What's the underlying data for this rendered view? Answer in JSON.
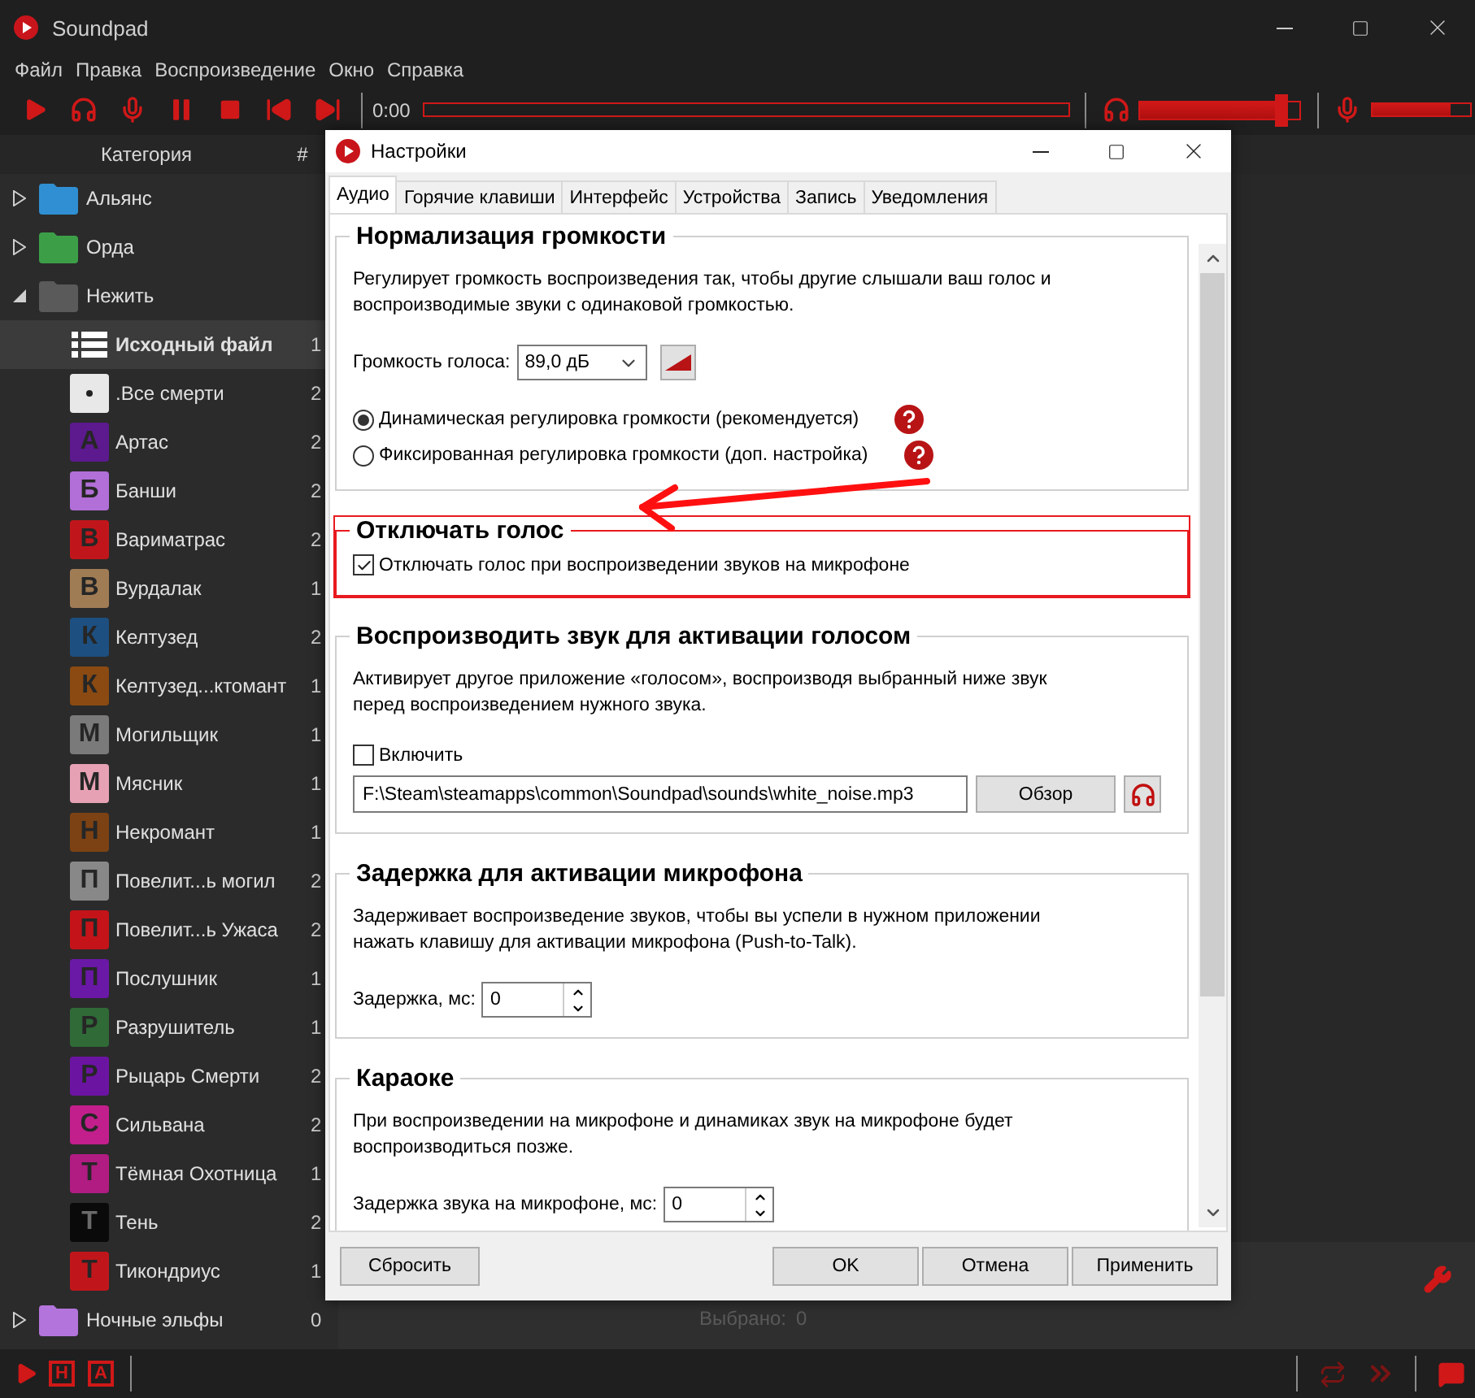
{
  "window": {
    "title": "Soundpad"
  },
  "menu": [
    "Файл",
    "Правка",
    "Воспроизведение",
    "Окно",
    "Справка"
  ],
  "player": {
    "time": "0:00",
    "progress": {
      "level": 0
    },
    "volume": {
      "level": 0.93
    },
    "mic": {
      "level": 0.8
    }
  },
  "sidebar": {
    "header": "Категория",
    "count_header": "#",
    "items": [
      {
        "label": "Альянс",
        "kind": "folder",
        "color": "#2f8fd2",
        "expanded": false,
        "selected": false
      },
      {
        "label": "Орда",
        "kind": "folder",
        "color": "#3c9f48",
        "expanded": false,
        "selected": false
      },
      {
        "label": "Нежить",
        "kind": "folder",
        "color": "#5a5a5a",
        "expanded": true,
        "selected": false,
        "children": [
          {
            "label": "Исходный файл",
            "count": "1",
            "kind": "list",
            "selected": true
          },
          {
            "label": ".Все смерти",
            "count": "2",
            "kind": "dot",
            "color": "#e8e8e8",
            "selected": false
          },
          {
            "label": "Артас",
            "count": "2",
            "kind": "letter",
            "badge": "А",
            "color": "#5c1a8e",
            "selected": false
          },
          {
            "label": "Банши",
            "count": "2",
            "kind": "letter",
            "badge": "Б",
            "color": "#b26fd8",
            "selected": false
          },
          {
            "label": "Вариматрас",
            "count": "2",
            "kind": "letter",
            "badge": "В",
            "color": "#c0161b",
            "selected": false
          },
          {
            "label": "Вурдалак",
            "count": "1",
            "kind": "letter",
            "badge": "В",
            "color": "#a07c55",
            "selected": false
          },
          {
            "label": "Келтузед",
            "count": "2",
            "kind": "letter",
            "badge": "К",
            "color": "#1d4f80",
            "selected": false
          },
          {
            "label": "Келтузед...ктомант",
            "count": "1",
            "kind": "letter",
            "badge": "К",
            "color": "#8a4a12",
            "selected": false
          },
          {
            "label": "Могильщик",
            "count": "1",
            "kind": "letter",
            "badge": "М",
            "color": "#7a7a7a",
            "selected": false
          },
          {
            "label": "Мясник",
            "count": "1",
            "kind": "letter",
            "badge": "М",
            "color": "#e6a1b4",
            "selected": false
          },
          {
            "label": "Некромант",
            "count": "1",
            "kind": "letter",
            "badge": "Н",
            "color": "#7c4214",
            "selected": false
          },
          {
            "label": "Повелит...ь могил",
            "count": "2",
            "kind": "letter",
            "badge": "П",
            "color": "#888888",
            "selected": false
          },
          {
            "label": "Повелит...ь Ужаса",
            "count": "2",
            "kind": "letter",
            "badge": "П",
            "color": "#c41419",
            "selected": false
          },
          {
            "label": "Послушник",
            "count": "1",
            "kind": "letter",
            "badge": "П",
            "color": "#6a18a6",
            "selected": false
          },
          {
            "label": "Разрушитель",
            "count": "1",
            "kind": "letter",
            "badge": "Р",
            "color": "#2f6a37",
            "selected": false
          },
          {
            "label": "Рыцарь Смерти",
            "count": "2",
            "kind": "letter",
            "badge": "Р",
            "color": "#6c14a2",
            "selected": false
          },
          {
            "label": "Сильвана",
            "count": "2",
            "kind": "letter",
            "badge": "С",
            "color": "#c21f8c",
            "selected": false
          },
          {
            "label": "Тёмная Охотница",
            "count": "1",
            "kind": "letter",
            "badge": "Т",
            "color": "#b01c82",
            "selected": false
          },
          {
            "label": "Тень",
            "count": "2",
            "kind": "letter",
            "badge": "Т",
            "color": "#0a0a0a",
            "selected": false
          },
          {
            "label": "Тикондриус",
            "count": "1",
            "kind": "letter",
            "badge": "Т",
            "color": "#c0161b",
            "selected": false
          }
        ]
      },
      {
        "label": "Ночные эльфы",
        "count": "0",
        "kind": "folder",
        "color": "#b374dc",
        "expanded": false,
        "selected": false
      }
    ]
  },
  "status": {
    "label": "Выбрано:",
    "value": "0"
  },
  "bottom_toolbar": [
    {
      "kind": "play"
    },
    {
      "kind": "letter",
      "label": "Н"
    },
    {
      "kind": "letter",
      "label": "А"
    }
  ],
  "dialog": {
    "title": "Настройки",
    "tabs": [
      {
        "label": "Аудио",
        "selected": true
      },
      {
        "label": "Горячие клавиши",
        "selected": false
      },
      {
        "label": "Интерфейс",
        "selected": false
      },
      {
        "label": "Устройства",
        "selected": false
      },
      {
        "label": "Запись",
        "selected": false
      },
      {
        "label": "Уведомления",
        "selected": false
      }
    ],
    "groups": [
      {
        "kind": "normalization",
        "title": "Нормализация громкости",
        "highlighted": false,
        "description": "Регулирует громкость воспроизведения так, чтобы другие слышали ваш голос и воспроизводимые звуки с одинаковой громкостью.",
        "volume_label": "Громкость голоса:",
        "volume_value": "89,0 дБ",
        "options": [
          {
            "label": "Динамическая регулировка громкости (рекомендуется)",
            "selected": true
          },
          {
            "label": "Фиксированная регулировка громкости (доп. настройка)",
            "selected": false
          }
        ]
      },
      {
        "kind": "mute",
        "title": "Отключать голос",
        "highlighted": true,
        "checkbox": {
          "label": "Отключать голос при воспроизведении звуков на микрофоне",
          "checked": true
        }
      },
      {
        "kind": "activation",
        "title": "Воспроизводить звук для активации голосом",
        "highlighted": false,
        "description": "Активирует другое приложение «голосом», воспроизводя выбранный ниже звук перед воспроизведением нужного звука.",
        "checkbox": {
          "label": "Включить",
          "checked": false
        },
        "path": "F:\\Steam\\steamapps\\common\\Soundpad\\sounds\\white_noise.mp3",
        "browse": "Обзор"
      },
      {
        "kind": "delay",
        "title": "Задержка для активации микрофона",
        "highlighted": false,
        "description": "Задерживает воспроизведение звуков, чтобы вы успели в нужном приложении нажать клавишу для активации микрофона (Push-to-Talk).",
        "field_label": "Задержка, мс:",
        "field_value": "0"
      },
      {
        "kind": "delay",
        "title": "Караоке",
        "highlighted": false,
        "description": "При воспроизведении на микрофоне и динамиках звук на микрофоне будет воспроизводиться позже.",
        "field_label": "Задержка звука на микрофоне, мс:",
        "field_value": "0"
      }
    ],
    "buttons": [
      {
        "kind": "reset",
        "label": "Сбросить"
      },
      {
        "kind": "ok",
        "label": "OK"
      },
      {
        "kind": "cancel",
        "label": "Отмена"
      },
      {
        "kind": "apply",
        "label": "Применить"
      }
    ],
    "annotation_arrow": true
  }
}
